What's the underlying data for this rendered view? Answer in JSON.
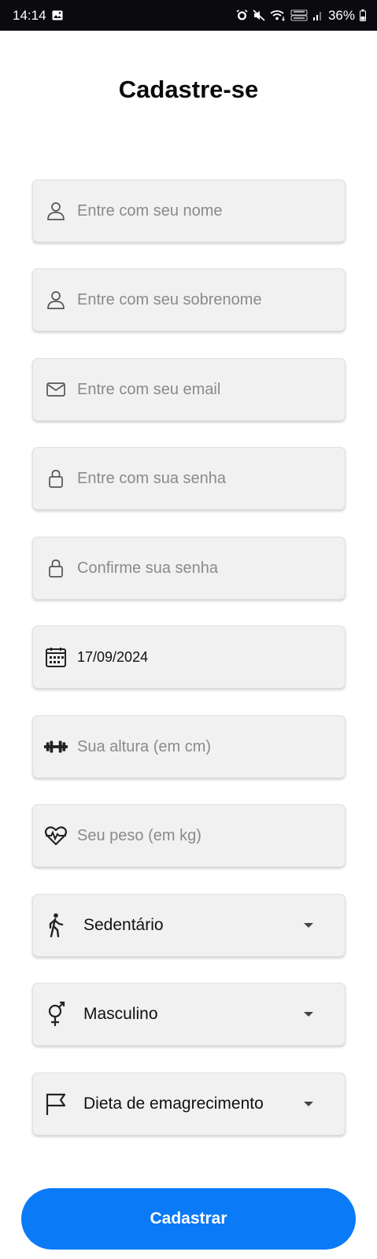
{
  "status_bar": {
    "time": "14:14",
    "battery": "36%"
  },
  "page_title": "Cadastre-se",
  "fields": {
    "first_name": {
      "placeholder": "Entre com seu nome",
      "icon": "person-icon"
    },
    "last_name": {
      "placeholder": "Entre com seu sobrenome",
      "icon": "person-icon"
    },
    "email": {
      "placeholder": "Entre com seu email",
      "icon": "mail-icon"
    },
    "password": {
      "placeholder": "Entre com sua senha",
      "icon": "lock-icon"
    },
    "confirm_password": {
      "placeholder": "Confirme sua senha",
      "icon": "lock-icon"
    },
    "birth_date": {
      "value": "17/09/2024",
      "icon": "calendar-icon"
    },
    "height": {
      "placeholder": "Sua altura (em cm)",
      "icon": "dumbbell-icon"
    },
    "weight": {
      "placeholder": "Seu peso (em kg)",
      "icon": "heart-pulse-icon"
    }
  },
  "selects": {
    "activity_level": {
      "value": "Sedentário",
      "icon": "walking-icon"
    },
    "sex": {
      "value": "Masculino",
      "icon": "gender-icon"
    },
    "diet": {
      "value": "Dieta de emagrecimento",
      "icon": "flag-icon"
    }
  },
  "submit_label": "Cadastrar",
  "colors": {
    "primary": "#0a7af7",
    "field_bg": "#f1f1f1",
    "placeholder": "#8a8a8a"
  }
}
